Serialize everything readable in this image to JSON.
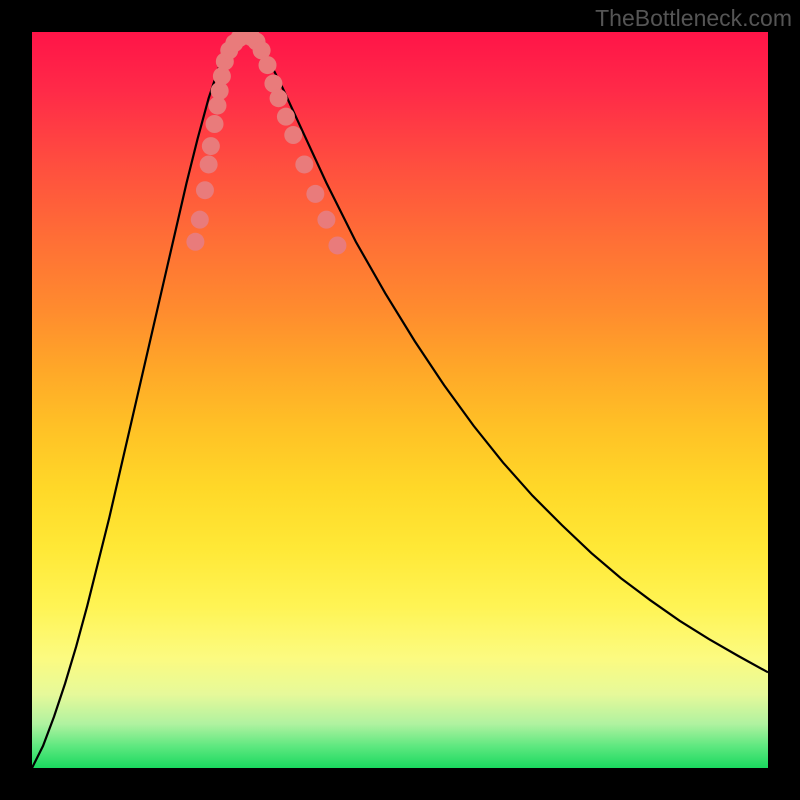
{
  "watermark": "TheBottleneck.com",
  "chart_data": {
    "type": "line",
    "title": "",
    "xlabel": "",
    "ylabel": "",
    "xlim": [
      0,
      100
    ],
    "ylim": [
      0,
      100
    ],
    "curve_left_points": [
      {
        "x": 0.0,
        "y": 0.0
      },
      {
        "x": 1.5,
        "y": 3.0
      },
      {
        "x": 3.0,
        "y": 7.0
      },
      {
        "x": 4.5,
        "y": 11.5
      },
      {
        "x": 6.0,
        "y": 16.5
      },
      {
        "x": 7.5,
        "y": 22.0
      },
      {
        "x": 9.0,
        "y": 28.0
      },
      {
        "x": 10.5,
        "y": 34.0
      },
      {
        "x": 12.0,
        "y": 40.5
      },
      {
        "x": 13.5,
        "y": 47.0
      },
      {
        "x": 15.0,
        "y": 53.5
      },
      {
        "x": 16.5,
        "y": 60.0
      },
      {
        "x": 18.0,
        "y": 66.5
      },
      {
        "x": 19.5,
        "y": 73.0
      },
      {
        "x": 21.0,
        "y": 79.5
      },
      {
        "x": 22.5,
        "y": 85.5
      },
      {
        "x": 24.0,
        "y": 91.0
      },
      {
        "x": 25.5,
        "y": 95.5
      },
      {
        "x": 27.0,
        "y": 98.5
      },
      {
        "x": 28.5,
        "y": 99.7
      }
    ],
    "curve_right_points": [
      {
        "x": 28.5,
        "y": 99.7
      },
      {
        "x": 30.0,
        "y": 99.3
      },
      {
        "x": 32.0,
        "y": 96.5
      },
      {
        "x": 34.0,
        "y": 92.5
      },
      {
        "x": 37.0,
        "y": 86.0
      },
      {
        "x": 40.0,
        "y": 79.5
      },
      {
        "x": 44.0,
        "y": 71.5
      },
      {
        "x": 48.0,
        "y": 64.5
      },
      {
        "x": 52.0,
        "y": 58.0
      },
      {
        "x": 56.0,
        "y": 52.0
      },
      {
        "x": 60.0,
        "y": 46.5
      },
      {
        "x": 64.0,
        "y": 41.5
      },
      {
        "x": 68.0,
        "y": 37.0
      },
      {
        "x": 72.0,
        "y": 33.0
      },
      {
        "x": 76.0,
        "y": 29.2
      },
      {
        "x": 80.0,
        "y": 25.8
      },
      {
        "x": 84.0,
        "y": 22.8
      },
      {
        "x": 88.0,
        "y": 20.0
      },
      {
        "x": 92.0,
        "y": 17.5
      },
      {
        "x": 96.0,
        "y": 15.2
      },
      {
        "x": 100.0,
        "y": 13.0
      }
    ],
    "scatter_points": [
      {
        "x": 22.2,
        "y": 71.5
      },
      {
        "x": 22.8,
        "y": 74.5
      },
      {
        "x": 23.5,
        "y": 78.5
      },
      {
        "x": 24.0,
        "y": 82.0
      },
      {
        "x": 24.3,
        "y": 84.5
      },
      {
        "x": 24.8,
        "y": 87.5
      },
      {
        "x": 25.2,
        "y": 90.0
      },
      {
        "x": 25.5,
        "y": 92.0
      },
      {
        "x": 25.8,
        "y": 94.0
      },
      {
        "x": 26.2,
        "y": 96.0
      },
      {
        "x": 26.8,
        "y": 97.5
      },
      {
        "x": 27.5,
        "y": 98.5
      },
      {
        "x": 28.2,
        "y": 99.2
      },
      {
        "x": 29.0,
        "y": 99.5
      },
      {
        "x": 29.8,
        "y": 99.3
      },
      {
        "x": 30.5,
        "y": 98.7
      },
      {
        "x": 31.2,
        "y": 97.5
      },
      {
        "x": 32.0,
        "y": 95.5
      },
      {
        "x": 32.8,
        "y": 93.0
      },
      {
        "x": 33.5,
        "y": 91.0
      },
      {
        "x": 34.5,
        "y": 88.5
      },
      {
        "x": 35.5,
        "y": 86.0
      },
      {
        "x": 37.0,
        "y": 82.0
      },
      {
        "x": 38.5,
        "y": 78.0
      },
      {
        "x": 40.0,
        "y": 74.5
      },
      {
        "x": 41.5,
        "y": 71.0
      }
    ],
    "scatter_color": "#e97b7b",
    "curve_color": "#000000"
  }
}
